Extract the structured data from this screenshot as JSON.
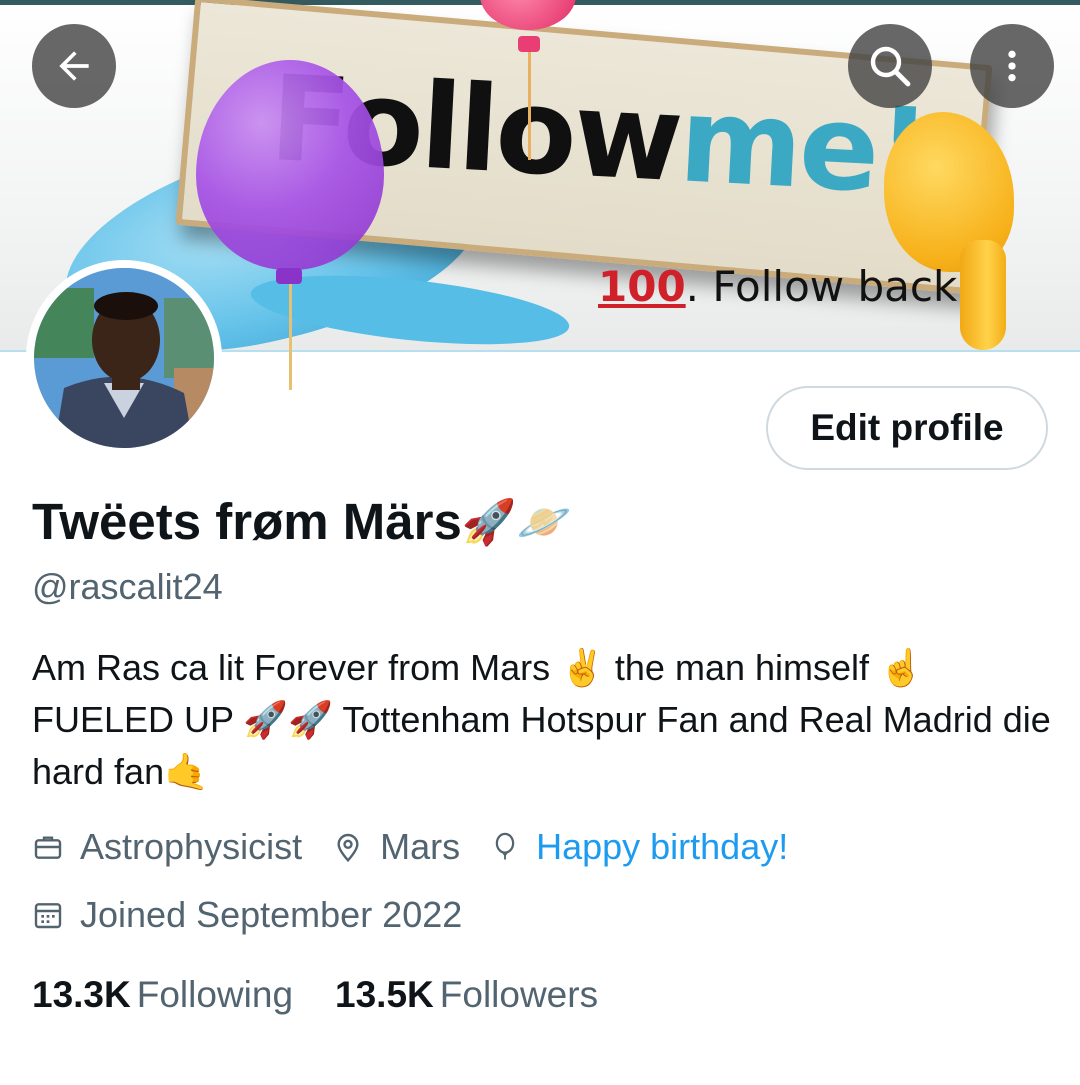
{
  "banner": {
    "sign_word1": "Follow",
    "sign_word2": "me!",
    "hundred": "100",
    "follow_back": ". Follow back"
  },
  "profile": {
    "display_name": "Twëets frøm Märs",
    "name_emojis": "🚀🪐",
    "handle": "@rascalit24",
    "bio": "Am Ras ca lit Forever from Mars ✌️ the man himself ☝️ FUELED UP 🚀🚀 Tottenham Hotspur Fan and Real Madrid die hard fan🤙",
    "edit_label": "Edit profile"
  },
  "meta": {
    "profession": "Astrophysicist",
    "location": "Mars",
    "birthday": "Happy birthday!",
    "joined": "Joined September 2022"
  },
  "stats": {
    "following_count": "13.3K",
    "following_label": "Following",
    "followers_count": "13.5K",
    "followers_label": "Followers"
  },
  "colors": {
    "accent": "#1d9bf0",
    "secondary_text": "#536471",
    "primary_text": "#0f1419"
  },
  "icons": [
    "back-arrow-icon",
    "search-icon",
    "more-vertical-icon",
    "briefcase-icon",
    "location-pin-icon",
    "balloon-icon",
    "calendar-icon"
  ]
}
